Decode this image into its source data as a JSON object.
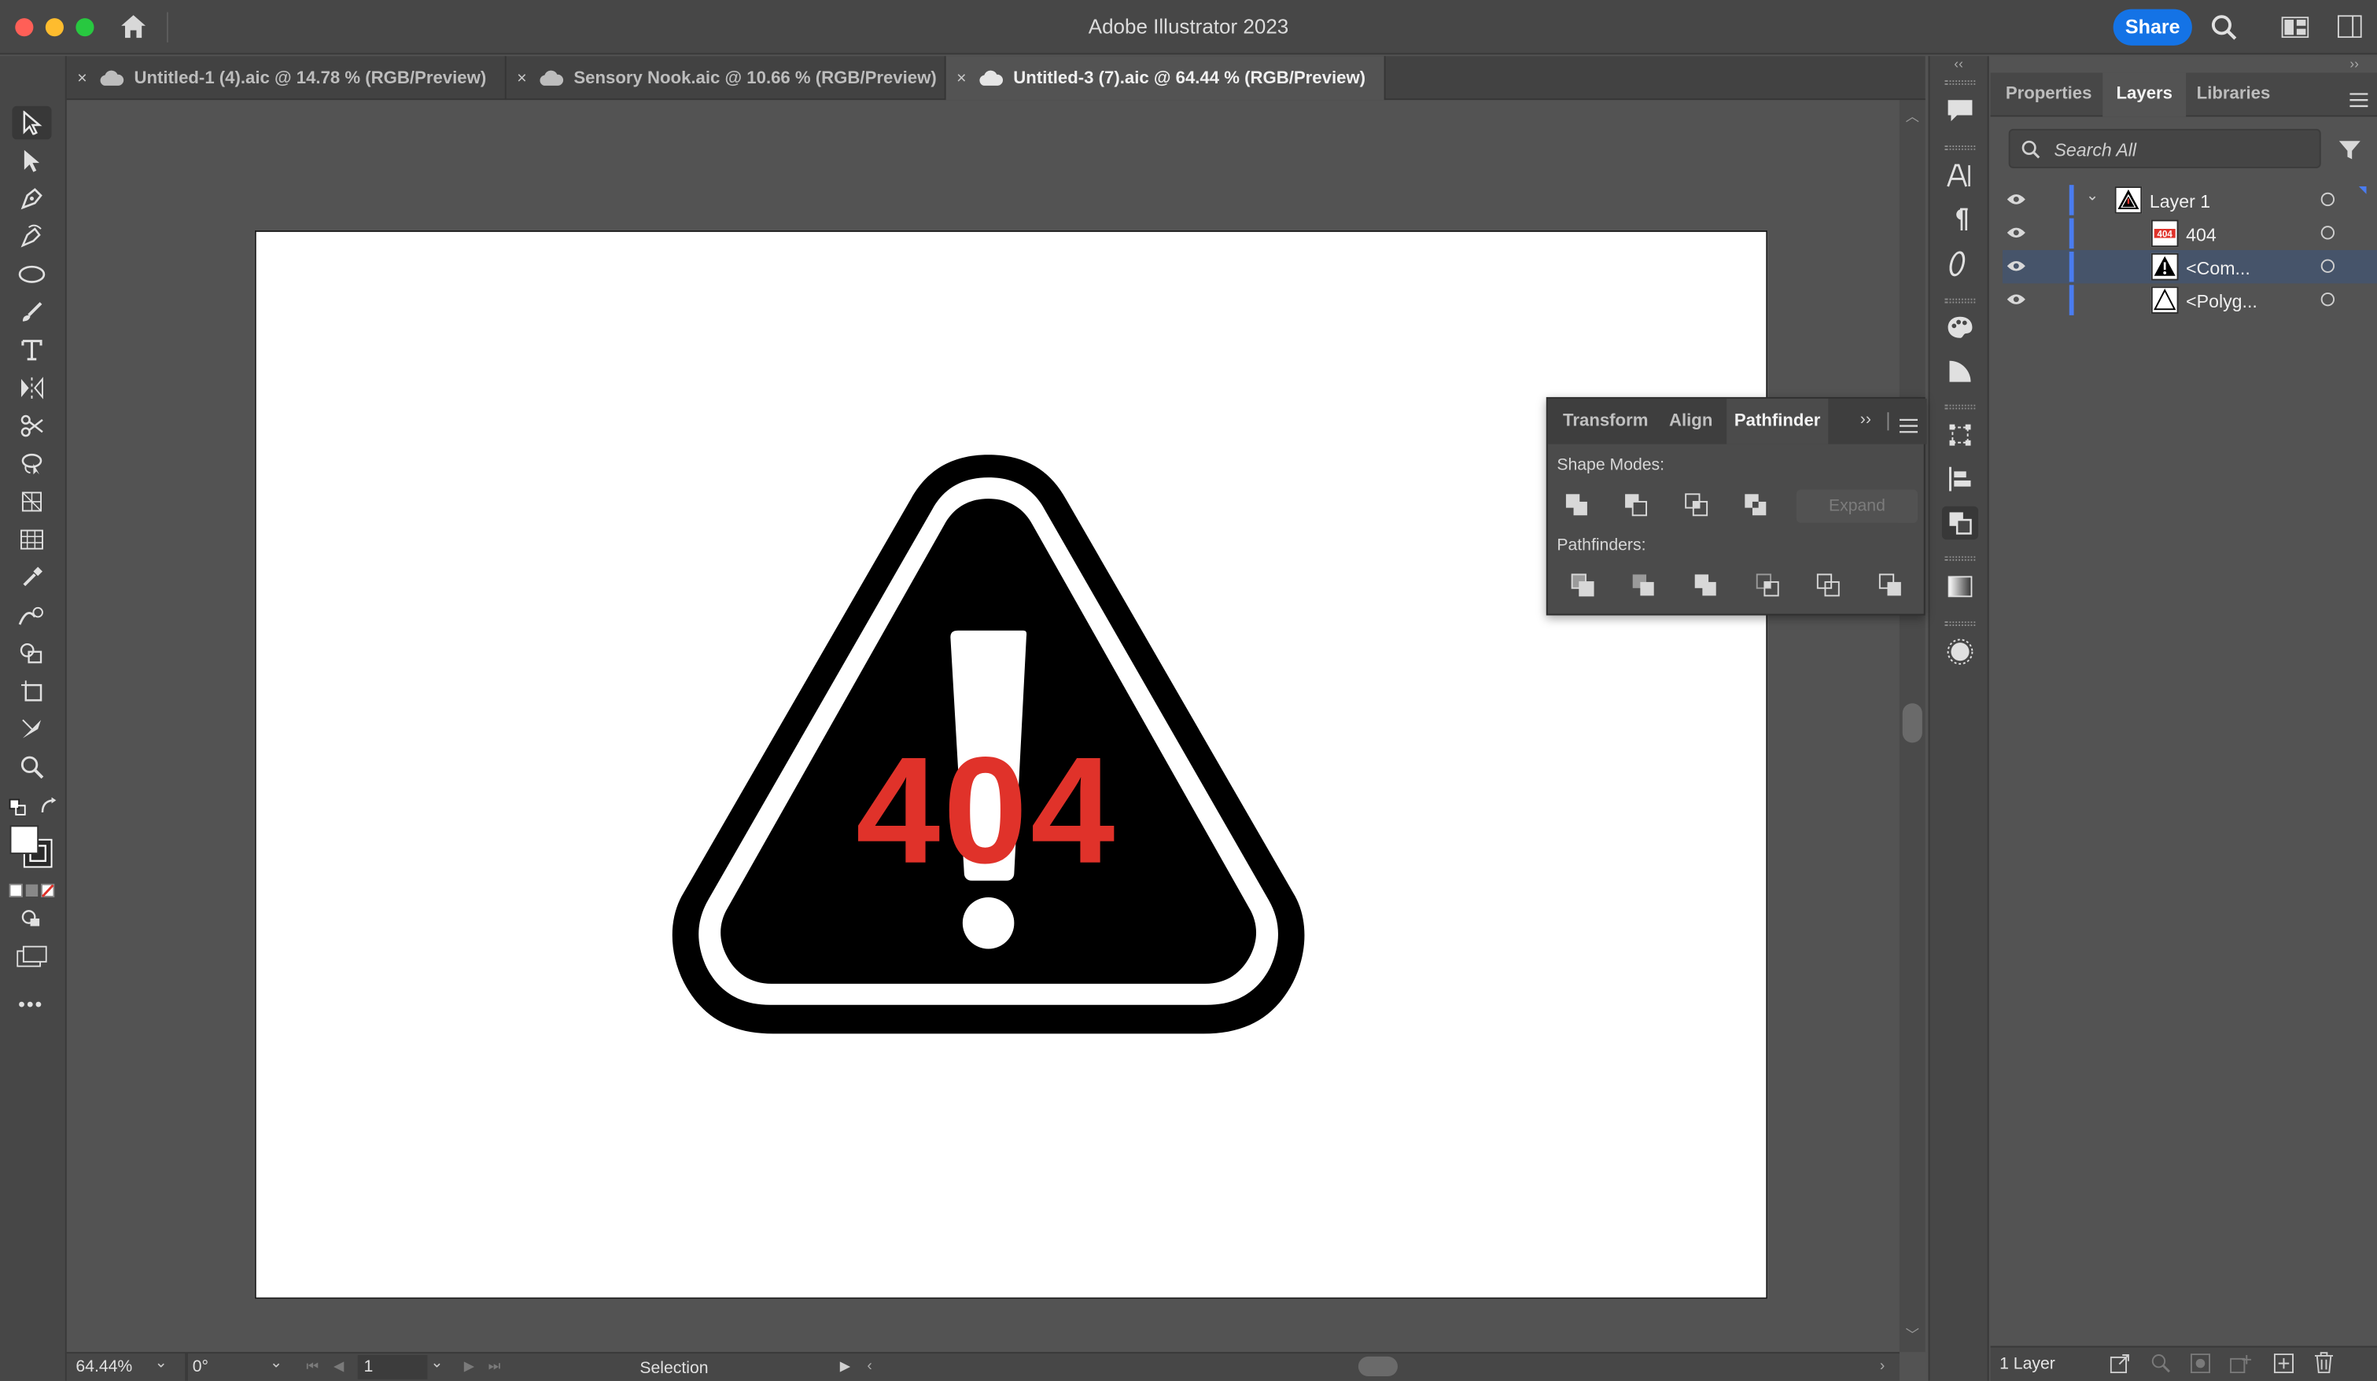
{
  "app": {
    "title": "Adobe Illustrator 2023",
    "share_label": "Share"
  },
  "tabs": [
    {
      "label": "Untitled-1 (4).aic @ 14.78 % (RGB/Preview)",
      "close": "×",
      "active": false
    },
    {
      "label": "Sensory Nook.aic @ 10.66 % (RGB/Preview)",
      "close": "×",
      "active": false
    },
    {
      "label": "Untitled-3 (7).aic @ 64.44 % (RGB/Preview)",
      "close": "×",
      "active": true
    }
  ],
  "toolbar": {
    "tools": [
      "selection-tool-icon",
      "direct-selection-tool-icon",
      "pen-tool-icon",
      "curvature-tool-icon",
      "ellipse-tool-icon",
      "paintbrush-tool-icon",
      "type-tool-icon",
      "reflect-tool-icon",
      "scissors-tool-icon",
      "lasso-tool-icon",
      "perspective-grid-tool-icon",
      "mesh-tool-icon",
      "eyedropper-tool-icon",
      "blend-tool-icon",
      "shape-builder-tool-icon",
      "artboard-tool-icon",
      "slice-tool-icon",
      "zoom-tool-icon"
    ],
    "more": "•••"
  },
  "artwork": {
    "text_404": "404",
    "colors": {
      "red": "#e0322a",
      "black": "#000000",
      "white": "#ffffff"
    }
  },
  "pathfinder_panel": {
    "tabs": [
      "Transform",
      "Align",
      "Pathfinder"
    ],
    "active_tab": "Pathfinder",
    "shape_modes_label": "Shape Modes:",
    "pathfinders_label": "Pathfinders:",
    "expand_label": "Expand",
    "collapse": "››"
  },
  "right_panel": {
    "tabs": [
      "Properties",
      "Layers",
      "Libraries"
    ],
    "active_tab": "Layers",
    "search_placeholder": "Search All",
    "layers": [
      {
        "name": "Layer 1",
        "indent": 0,
        "expanded": true,
        "selected": false,
        "thumb": "warning"
      },
      {
        "name": "404",
        "indent": 1,
        "selected": false,
        "thumb": "404"
      },
      {
        "name": "<Com...",
        "indent": 1,
        "selected": true,
        "thumb": "warning-black"
      },
      {
        "name": "<Polyg...",
        "indent": 1,
        "selected": false,
        "thumb": "triangle-outline"
      }
    ],
    "footer_count": "1 Layer"
  },
  "status_bar": {
    "zoom": "64.44%",
    "rotation": "0°",
    "artboard_number": "1",
    "tool_name": "Selection"
  }
}
